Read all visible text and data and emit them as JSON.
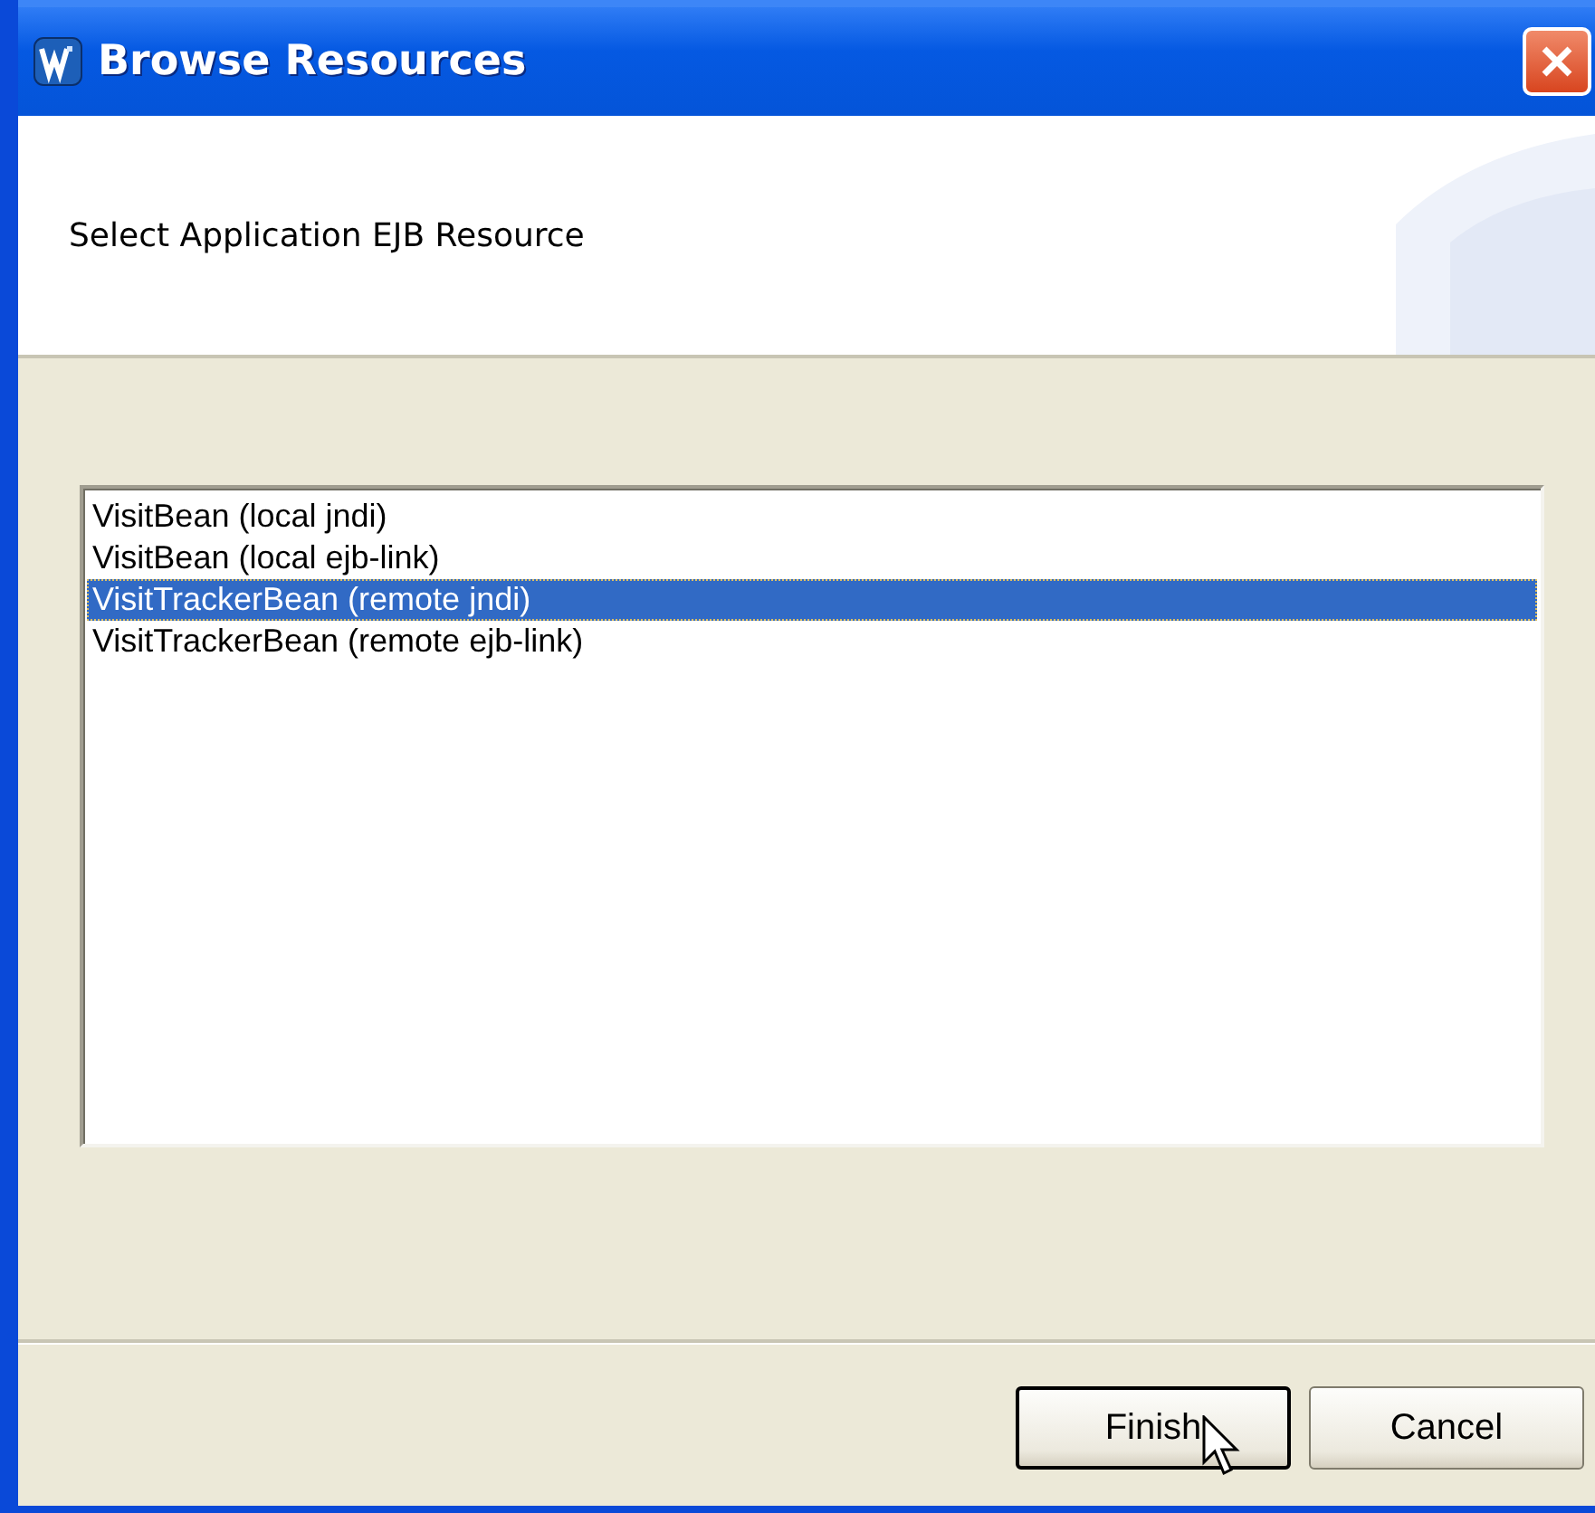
{
  "window": {
    "title": "Browse Resources"
  },
  "header": {
    "instruction": "Select Application EJB Resource"
  },
  "list": {
    "items": [
      {
        "label": "VisitBean (local jndi)",
        "selected": false
      },
      {
        "label": "VisitBean (local ejb-link)",
        "selected": false
      },
      {
        "label": "VisitTrackerBean (remote jndi)",
        "selected": true
      },
      {
        "label": "VisitTrackerBean (remote ejb-link)",
        "selected": false
      }
    ]
  },
  "buttons": [
    {
      "label": "Finish",
      "kind": "default"
    },
    {
      "label": "Cancel",
      "kind": "normal"
    }
  ]
}
